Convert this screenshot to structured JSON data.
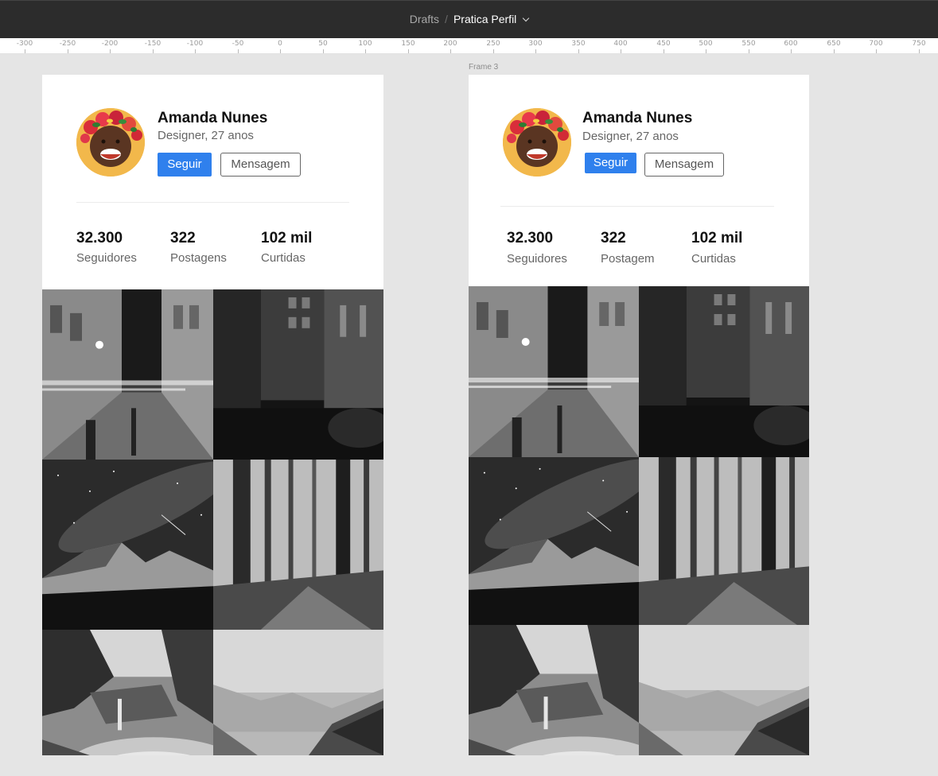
{
  "topbar": {
    "drafts": "Drafts",
    "separator": "/",
    "file_name": "Pratica Perfil"
  },
  "ruler": {
    "ticks": [
      "-300",
      "-250",
      "-200",
      "-150",
      "-100",
      "-50",
      "0",
      "50",
      "100",
      "150",
      "200",
      "250",
      "300",
      "350",
      "400",
      "450",
      "500",
      "550",
      "600",
      "650",
      "700",
      "750"
    ]
  },
  "frame2_label": "Frame 3",
  "frame1": {
    "profile": {
      "name": "Amanda Nunes",
      "role": "Designer, 27 anos",
      "follow_label": "Seguir",
      "message_label": "Mensagem"
    },
    "stats": [
      {
        "value": "32.300",
        "label": "Seguidores"
      },
      {
        "value": "322",
        "label": "Postagens"
      },
      {
        "value": "102 mil",
        "label": "Curtidas"
      }
    ]
  },
  "frame2": {
    "profile": {
      "name": "Amanda Nunes",
      "role": "Designer, 27 anos",
      "follow_label": "Seguir",
      "message_label": "Mensagem"
    },
    "stats": [
      {
        "value": "32.300",
        "label": "Seguidores"
      },
      {
        "value": "322",
        "label": "Postagem"
      },
      {
        "value": "102 mil",
        "label": "Curtidas"
      }
    ]
  },
  "photos": [
    "street-night-photo",
    "city-street-dark-photo",
    "milky-way-mountains-photo",
    "forest-photo",
    "coastal-waterfall-photo",
    "mountain-valley-photo"
  ],
  "colors": {
    "follow_button": "#2f80ed",
    "topbar": "#2c2c2c",
    "canvas": "#e5e5e5"
  }
}
